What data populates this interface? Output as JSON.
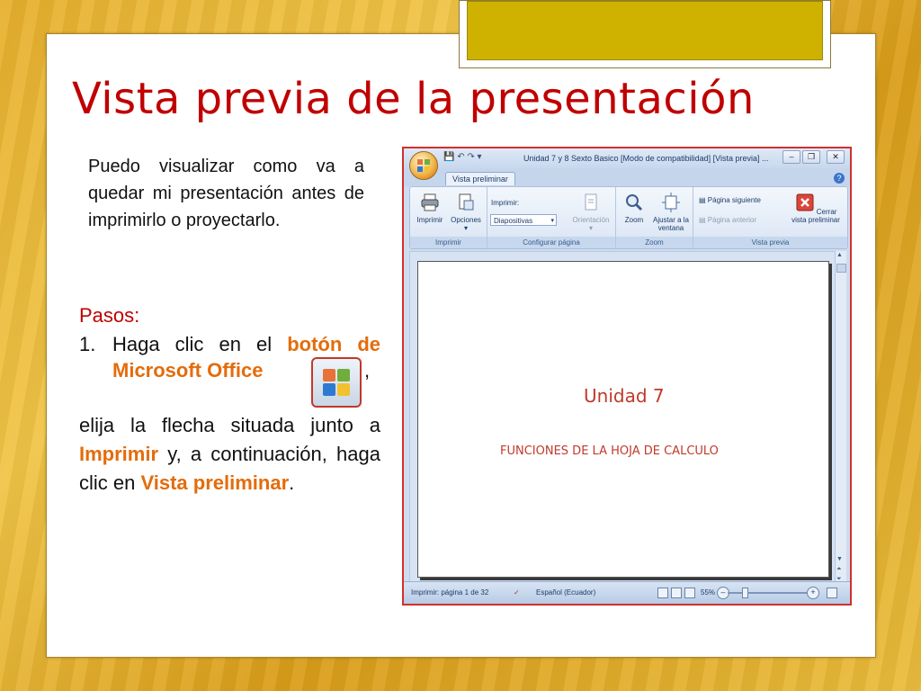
{
  "title": "Vista previa de la presentación",
  "intro": "Puedo visualizar como va a quedar mi presentación antes de imprimirlo o proyectarlo.",
  "steps_title": "Pasos:",
  "step1": {
    "number": "1.",
    "text_before": "Haga clic en el",
    "highlight": "botón de Microsoft Office",
    "comma": ","
  },
  "para2": {
    "t1": "elija la flecha situada junto a",
    "h1": "Imprimir",
    "t2": "y, a continuación, haga clic en",
    "h2": "Vista preliminar",
    "t3": "."
  },
  "screenshot": {
    "window_title": "Unidad 7 y 8 Sexto Basico [Modo de compatibilidad] [Vista previa] ...",
    "tab": "Vista preliminar",
    "help": "?",
    "groups": {
      "imprimir": "Imprimir",
      "configurar": "Configurar página",
      "zoom": "Zoom",
      "vista_previa": "Vista previa"
    },
    "buttons": {
      "imprimir": "Imprimir",
      "opciones": "Opciones",
      "imprimir_label": "Imprimir:",
      "diapositivas": "Diapositivas",
      "orientacion": "Orientación",
      "zoom": "Zoom",
      "ajustar": "Ajustar a la ventana",
      "pagina_siguiente": "Página siguiente",
      "pagina_anterior": "Página anterior",
      "cerrar": "Cerrar vista preliminar"
    },
    "page_title": "Unidad 7",
    "page_subtitle": "FUNCIONES DE LA HOJA DE CALCULO",
    "status": {
      "page": "Imprimir: página 1 de 32",
      "language": "Español (Ecuador)",
      "zoom": "55%"
    }
  },
  "colors": {
    "title": "#c00000",
    "highlight": "#e46c0a",
    "accent": "#cfb100"
  }
}
